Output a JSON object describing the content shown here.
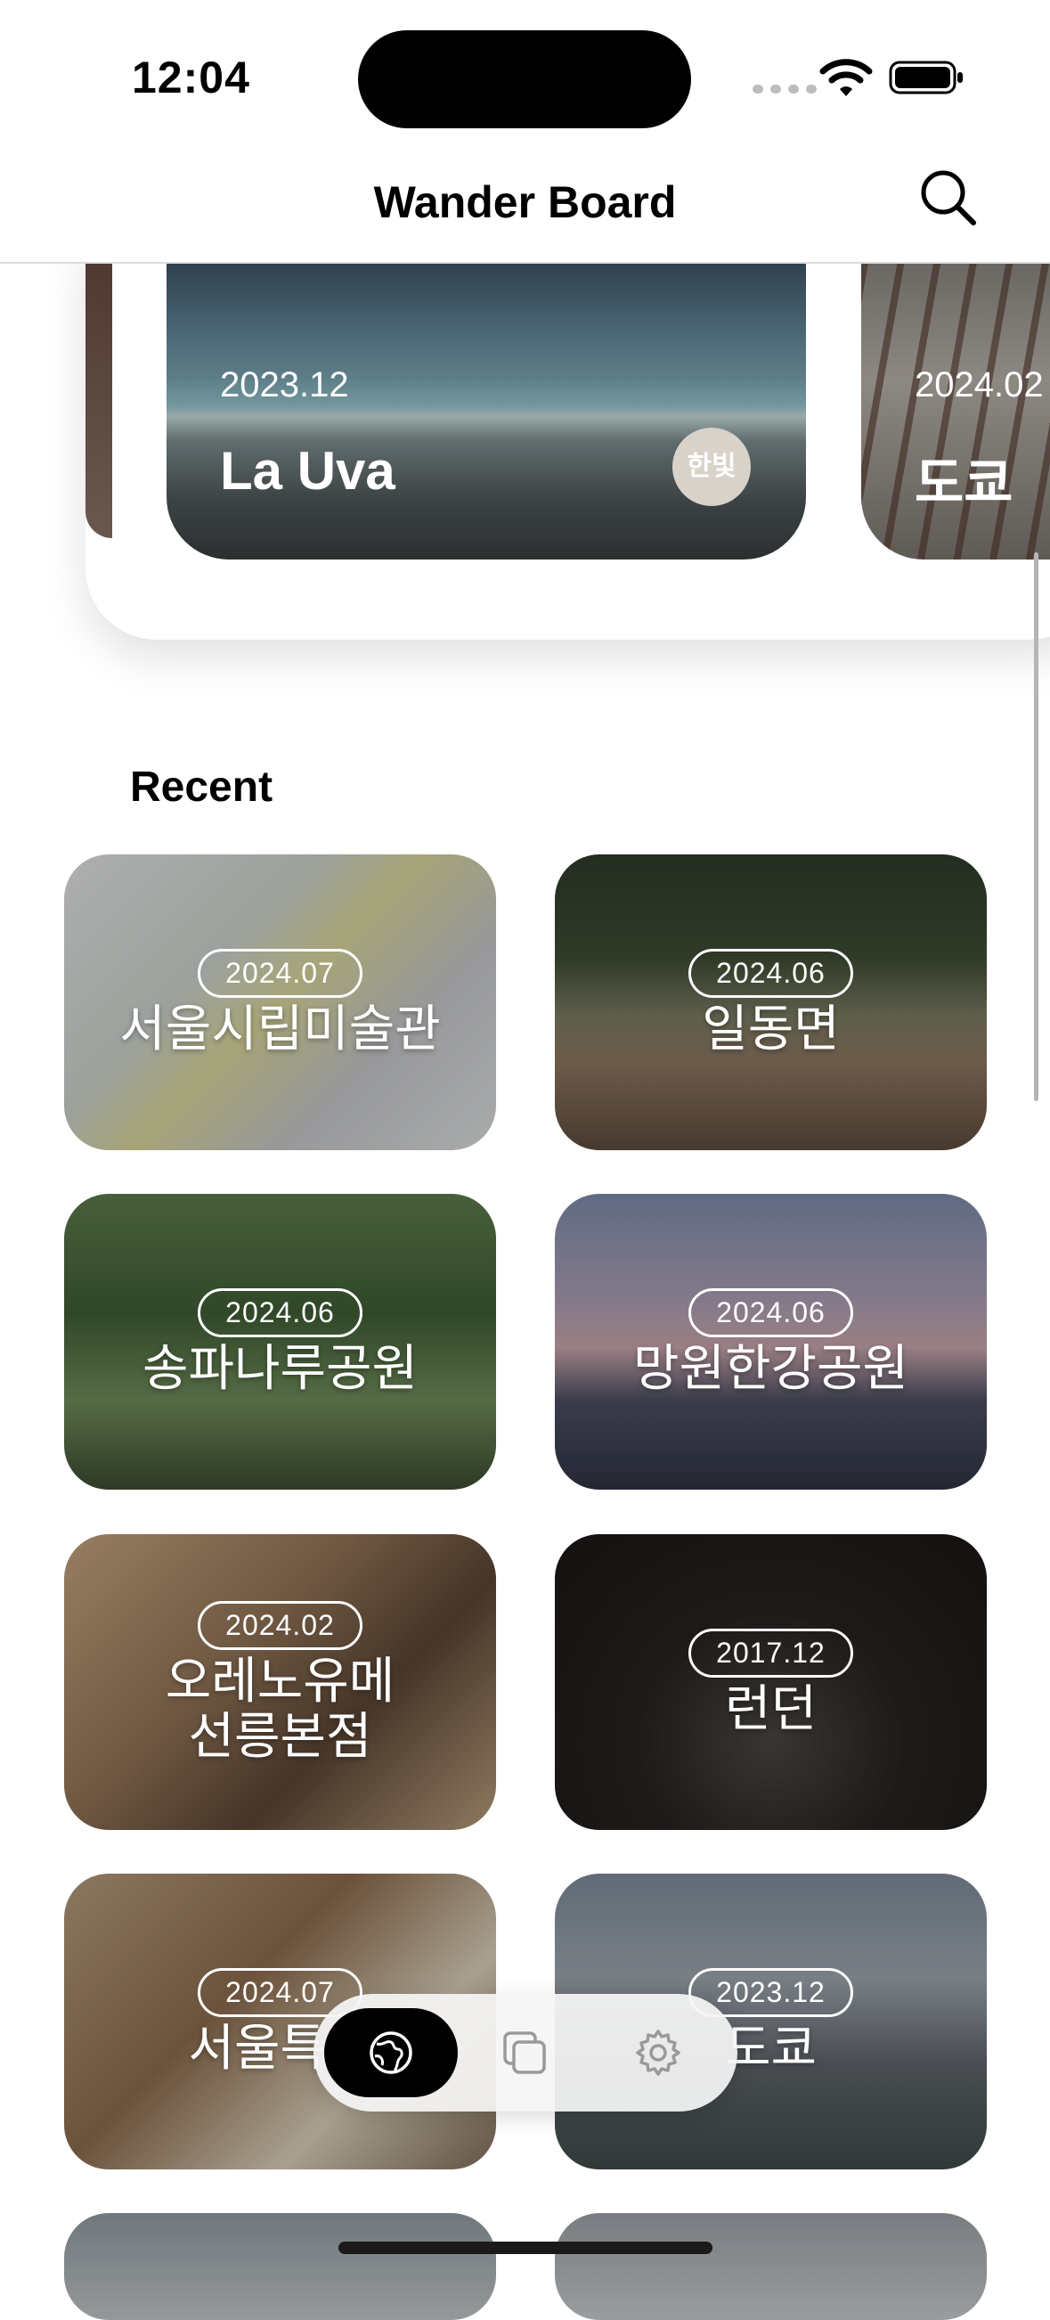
{
  "status_bar": {
    "time": "12:04"
  },
  "header": {
    "title": "Wander Board"
  },
  "featured": [
    {
      "date": "2023.12",
      "name": "La Uva",
      "owner": "한빛"
    },
    {
      "date": "2024.02",
      "name": "도쿄"
    }
  ],
  "recent": {
    "title": "Recent",
    "items": [
      {
        "date": "2024.07",
        "name": "서울시립미술관"
      },
      {
        "date": "2024.06",
        "name": "일동면"
      },
      {
        "date": "2024.06",
        "name": "송파나루공원"
      },
      {
        "date": "2024.06",
        "name": "망원한강공원"
      },
      {
        "date": "2024.02",
        "name": "오레노유메\n선릉본점"
      },
      {
        "date": "2017.12",
        "name": "런던"
      },
      {
        "date": "2024.07",
        "name": "서울특별"
      },
      {
        "date": "2023.12",
        "name": "도쿄"
      }
    ]
  },
  "tab_bar": {
    "active": "explore",
    "icons": [
      "globe-icon",
      "collections-icon",
      "gear-icon"
    ]
  }
}
